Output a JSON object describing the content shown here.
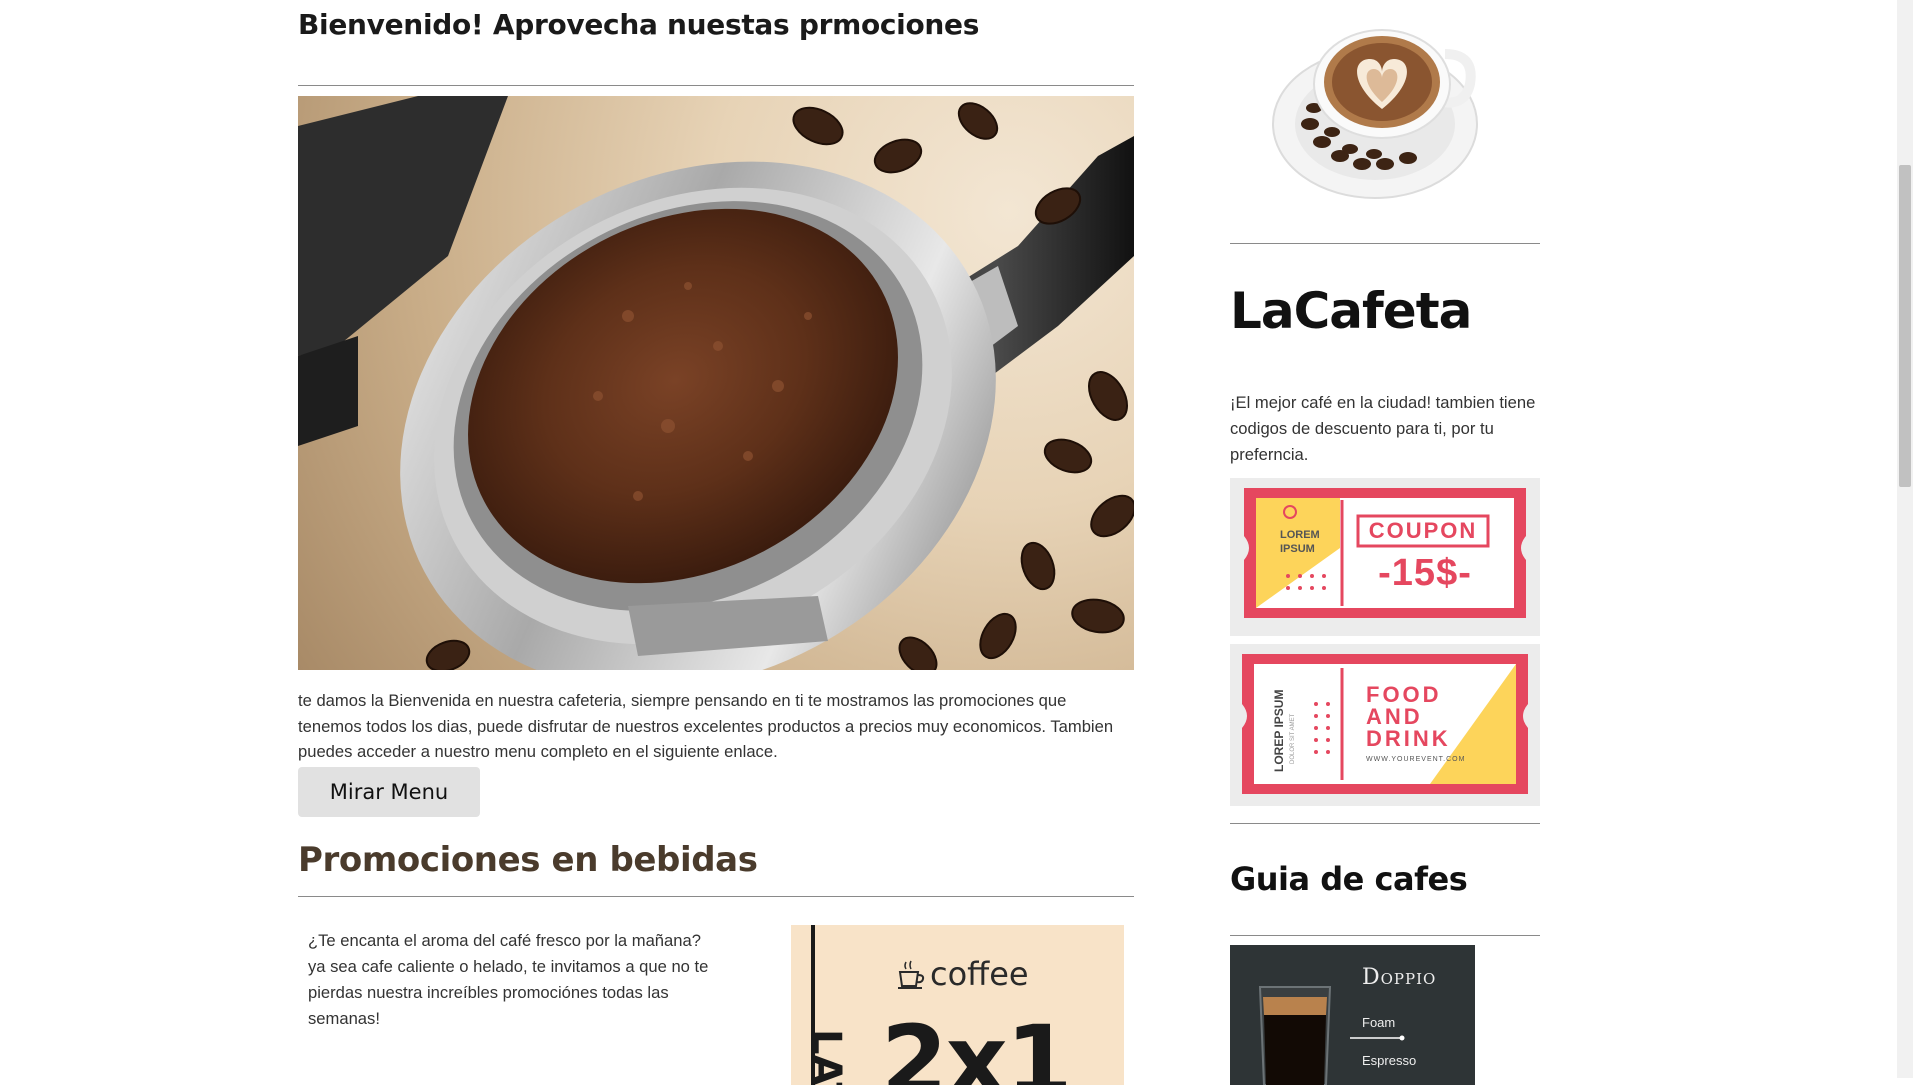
{
  "main": {
    "welcome_title": "Bienvenido! Aprovecha nuestas prmociones",
    "intro_text": "te damos la Bienvenida en nuestra cafeteria, siempre pensando en ti te mostramos las promociones que tenemos todos los dias, puede disfrutar de nuestros excelentes productos a precios muy economicos. Tambien puedes acceder a nuestro menu completo en el siguiente enlace.",
    "menu_button_label": "Mirar Menu",
    "promo_section_title": "Promociones en bebidas",
    "promo_text": "¿Te encanta el aroma del café fresco por la mañana? ya sea cafe caliente o helado, te invitamos a que no te pierdas nuestra increíbles promociónes todas las semanas!",
    "promo_card": {
      "brand": "coffee",
      "partial_side_text": "LAT",
      "deal": "2x1"
    }
  },
  "sidebar": {
    "brand_name": "LaCafeta",
    "tagline": "¡El mejor café en la ciudad! tambien tiene codigos de descuento para ti, por tu preferncia.",
    "coupon_1": {
      "small_text": "LOREM IPSUM",
      "title": "COUPON",
      "amount": "-15$-"
    },
    "coupon_2": {
      "side_text": "LOREP IPSUM",
      "side_subtext": "DOLOR SIT AMET",
      "title_lines": [
        "FOOD",
        "AND",
        "DRINK"
      ],
      "url": "WWW.YOUREVENT.COM"
    },
    "guide_title": "Guia de cafes",
    "guide_card": {
      "title": "Doppio",
      "labels": [
        "Foam",
        "Espresso"
      ]
    }
  },
  "colors": {
    "promo_title": "#4a3b2c",
    "coupon_red": "#e5475f",
    "coupon_yellow": "#fdd45a",
    "button_bg": "#e1e1e1"
  }
}
